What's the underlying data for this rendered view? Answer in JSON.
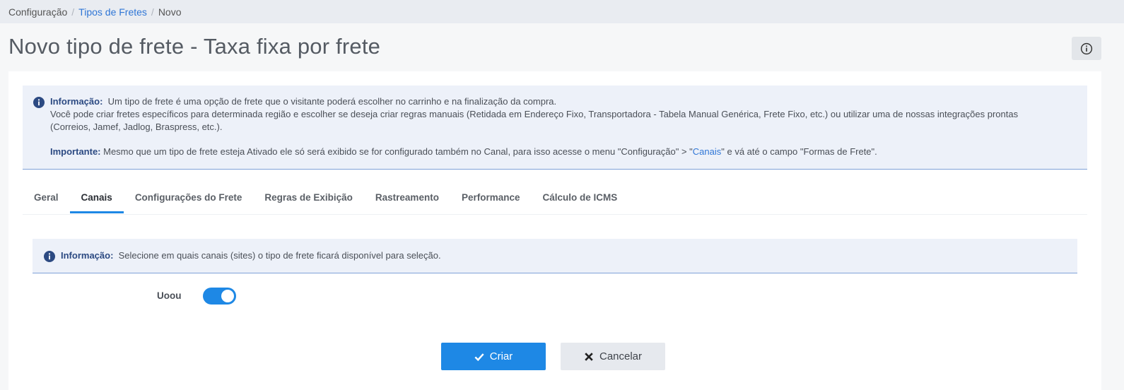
{
  "breadcrumb": {
    "items": [
      "Configuração",
      "Tipos de Fretes",
      "Novo"
    ],
    "separator": "/"
  },
  "page": {
    "title": "Novo tipo de frete - Taxa fixa por frete",
    "help_icon": "info-circle-icon"
  },
  "info_alert": {
    "label": "Informação:",
    "line1": "Um tipo de frete é uma opção de frete que o visitante poderá escolher no carrinho e na finalização da compra.",
    "line2": "Você pode criar fretes específicos para determinada região e escolher se deseja criar regras manuais (Retidada em Endereço Fixo, Transportadora - Tabela Manual Genérica, Frete Fixo, etc.) ou utilizar uma de nossas integrações prontas (Correios, Jamef, Jadlog, Braspress, etc.).",
    "important_label": "Importante:",
    "important_text_before": "Mesmo que um tipo de frete esteja Ativado ele só será exibido se for configurado também no Canal, para isso acesse o menu \"Configuração\" > \"",
    "important_link": "Canais",
    "important_text_after": "\" e vá até o campo \"Formas de Frete\"."
  },
  "tabs": [
    "Geral",
    "Canais",
    "Configurações do Frete",
    "Regras de Exibição",
    "Rastreamento",
    "Performance",
    "Cálculo de ICMS"
  ],
  "active_tab": "Canais",
  "canais_alert": {
    "label": "Informação:",
    "text": "Selecione em quais canais (sites) o tipo de frete ficará disponível para seleção."
  },
  "channels": [
    {
      "name": "Uoou",
      "enabled": true
    }
  ],
  "actions": {
    "create_label": "Criar",
    "cancel_label": "Cancelar"
  },
  "colors": {
    "accent": "#1e88e5",
    "link": "#2f76d6",
    "alert_bg": "#edf1f9"
  }
}
